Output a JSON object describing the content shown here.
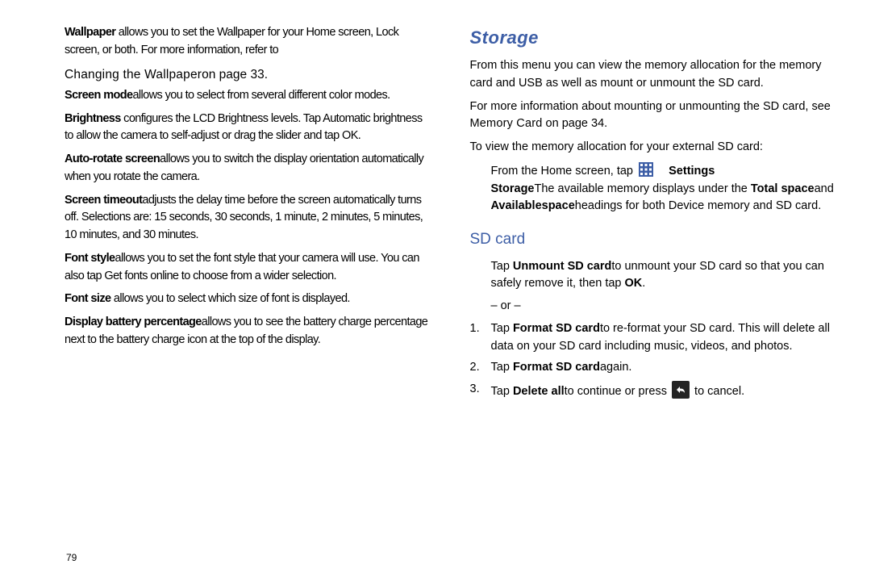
{
  "page_number": "79",
  "left": {
    "wallpaper": {
      "term": "Wallpaper",
      "body": " allows you to set the Wallpaper for your Home screen, Lock screen, or both. For more information, refer to",
      "ref": "Changing the Wallpaper",
      "reftail": "on page 33."
    },
    "screenmode": {
      "term": "Screen mode",
      "body": "allows you to select from several different color modes."
    },
    "brightness": {
      "term": "Brightness",
      "body": " configures the LCD Brightness levels. Tap Automatic brightness to allow the camera to self-adjust or drag the slider and tap OK."
    },
    "autorotate": {
      "term": "Auto-rotate screen",
      "body": "allows you to switch the display orientation automatically when you rotate the camera."
    },
    "screentimeout": {
      "term": "Screen timeout",
      "body": "adjusts the delay time before the screen automatically turns off. Selections are: 15 seconds, 30 seconds, 1 minute, 2 minutes, 5 minutes, 10 minutes, and 30 minutes."
    },
    "fontstyle": {
      "term": "Font style",
      "body": "allows you to set the font style that your camera will use. You can also tap Get fonts online to choose from a wider selection."
    },
    "fontsize": {
      "term": "Font size",
      "body": " allows you to select which size of font is displayed."
    },
    "battery": {
      "term": "Display battery percentage",
      "body": "allows you to see the battery charge percentage next to the battery charge icon at the top of the display."
    }
  },
  "right": {
    "heading": "Storage",
    "p1": "From this menu you can view the memory allocation for the memory card and USB as well as mount or unmount the SD card.",
    "p2a": "For more information about mounting or unmounting the SD card, see ",
    "p2ref": "Memory Card",
    "p2b": " on page 34.",
    "p3": "To view the memory allocation for your external SD card:",
    "tap_line": {
      "a": "From the Home screen, tap ",
      "settings": "Settings",
      "arrow": " ",
      "storage": "Storage",
      "b": "The available memory displays under the ",
      "total": "Total space",
      "c": "and ",
      "avail_label": "Available",
      "avail_suffix": "space",
      "d": "headings for both Device memory and SD card."
    },
    "sdcard_heading": "SD card",
    "unmount": {
      "a": "Tap ",
      "term": "Unmount SD card",
      "b": "to unmount your SD card so that you can safely remove it, then tap ",
      "ok": "OK",
      "dot": "."
    },
    "or": "– or –",
    "step1": {
      "num": "1.",
      "a": "Tap ",
      "term": "Format SD card",
      "b": "to re-format your SD card. This will delete all data on your SD card including music, videos, and photos."
    },
    "step2": {
      "num": "2.",
      "a": "Tap ",
      "term": "Format SD card",
      "b": "again."
    },
    "step3": {
      "num": "3.",
      "a": "Tap ",
      "term": "Delete all",
      "b": "to continue or press ",
      "c": " to cancel."
    }
  }
}
